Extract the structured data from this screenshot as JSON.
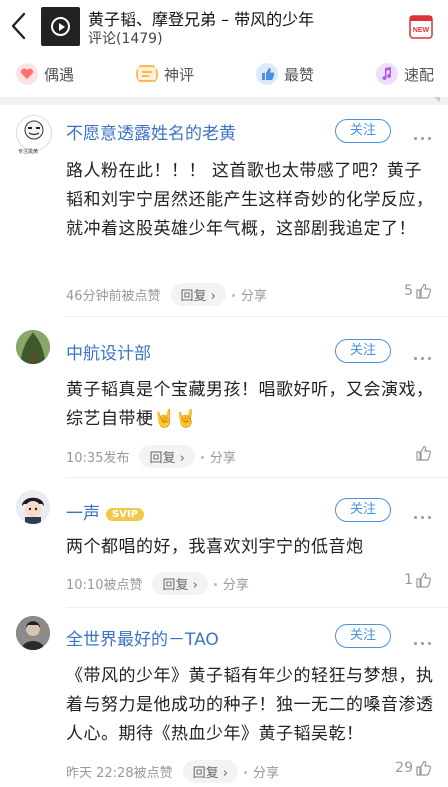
{
  "header": {
    "song_title": "黄子韬、摩登兄弟 – 带风的少年",
    "comment_count": "评论(1479)",
    "new_badge": "NEW"
  },
  "tabs": [
    {
      "label": "偶遇",
      "icon": "heart-icon",
      "color": "#ff6f73"
    },
    {
      "label": "神评",
      "icon": "chat-icon",
      "color": "#f5a623"
    },
    {
      "label": "最赞",
      "icon": "thumb-icon",
      "color": "#4a90e2"
    },
    {
      "label": "速配",
      "icon": "music-icon",
      "color": "#b05ee8"
    }
  ],
  "comments": [
    {
      "name": "不愿意透露姓名的老黄",
      "follow": "关注",
      "text": "路人粉在此！！！ 这首歌也太带感了吧？黄子韬和刘宇宁居然还能产生这样奇妙的化学反应，就冲着这股英雄少年气概，这部剧我追定了！",
      "time": "46分钟前被点赞",
      "reply": "回复 ›",
      "share": "分享",
      "likes": "5",
      "avatar_text": "专注黑黄"
    },
    {
      "name": "中航设计部",
      "follow": "关注",
      "text": "黄子韬真是个宝藏男孩！唱歌好听，又会演戏，综艺自带梗🤘🤘",
      "time": "10:35发布",
      "reply": "回复 ›",
      "share": "分享",
      "likes": ""
    },
    {
      "name": "一声",
      "badge": "SVIP",
      "follow": "关注",
      "text": "两个都唱的好，我喜欢刘宇宁的低音炮",
      "time": "10:10被点赞",
      "reply": "回复 ›",
      "share": "分享",
      "likes": "1"
    },
    {
      "name": "全世界最好的－TAO",
      "follow": "关注",
      "text": "《带风的少年》黄子韬有年少的轻狂与梦想，执着与努力是他成功的种子！独一无二的嗓音渗透人心。期待《热血少年》黄子韬吴乾！",
      "time": "昨天 22:28被点赞",
      "reply": "回复 ›",
      "share": "分享",
      "likes": "29"
    }
  ]
}
